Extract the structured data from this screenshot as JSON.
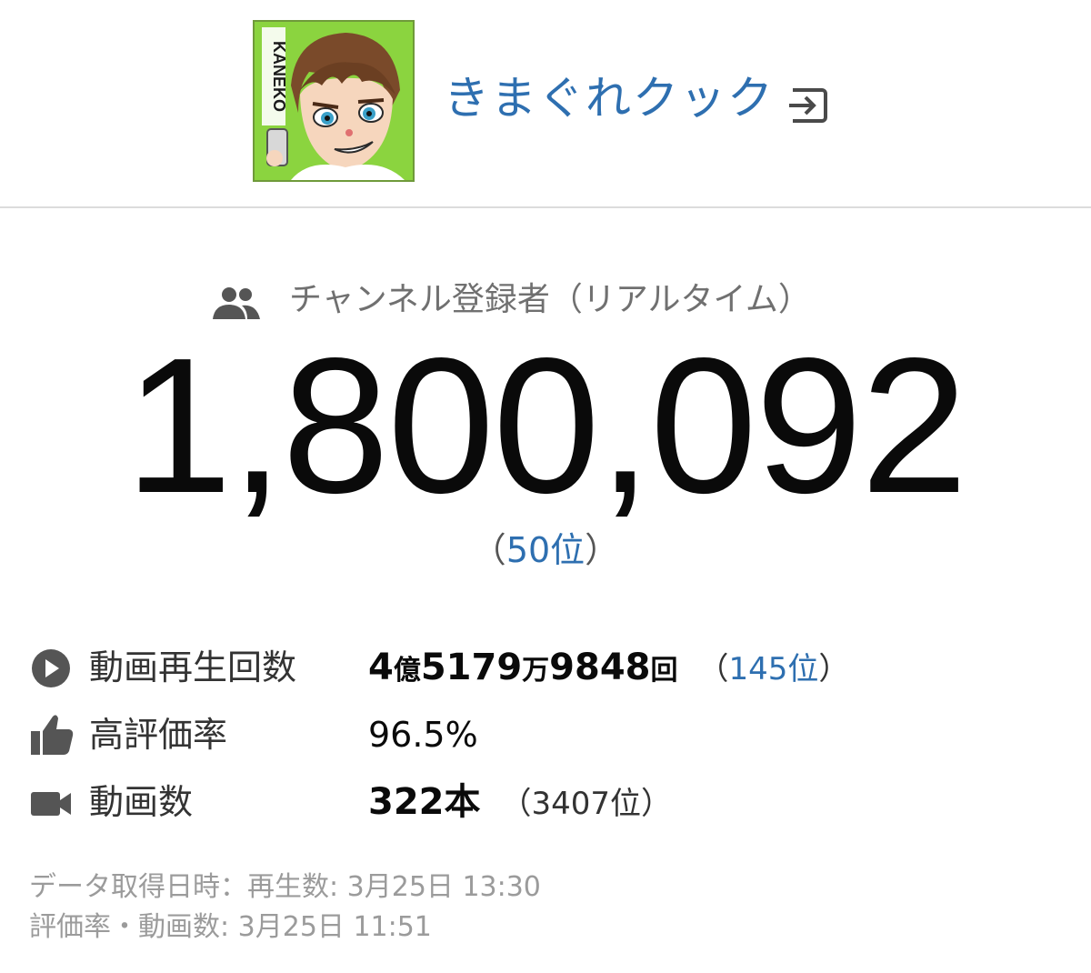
{
  "channel": {
    "name": "きまぐれクック",
    "avatar_icon": "channel-avatar-image",
    "avatar_text": "KANEKO",
    "login_icon": "login-arrow-icon"
  },
  "subscribers": {
    "label": "チャンネル登録者（リアルタイム）",
    "count": "1,800,092",
    "rank_open": "（",
    "rank_value": "50位",
    "rank_close": "）",
    "icon": "people-icon"
  },
  "stats": {
    "views": {
      "label": "動画再生回数",
      "value_part1": "4",
      "unit1": "億",
      "value_part2": "5179",
      "unit2": "万",
      "value_part3": "9848",
      "unit3": "回",
      "rank_open": "（",
      "rank_value": "145位",
      "rank_close": "）",
      "icon": "play-icon"
    },
    "rating": {
      "label": "高評価率",
      "value": "96.5%",
      "icon": "thumbs-up-icon"
    },
    "videos": {
      "label": "動画数",
      "value_num": "322",
      "value_unit": "本",
      "rank": "（3407位）",
      "icon": "video-camera-icon"
    }
  },
  "footnotes": {
    "line1": "データ取得日時：再生数: 3月25日 13:30",
    "line2": "評価率・動画数: 3月25日 11:51"
  },
  "colors": {
    "link": "#2e6fb0",
    "avatar_bg": "#8bd43f",
    "muted": "#9b9b9b"
  }
}
